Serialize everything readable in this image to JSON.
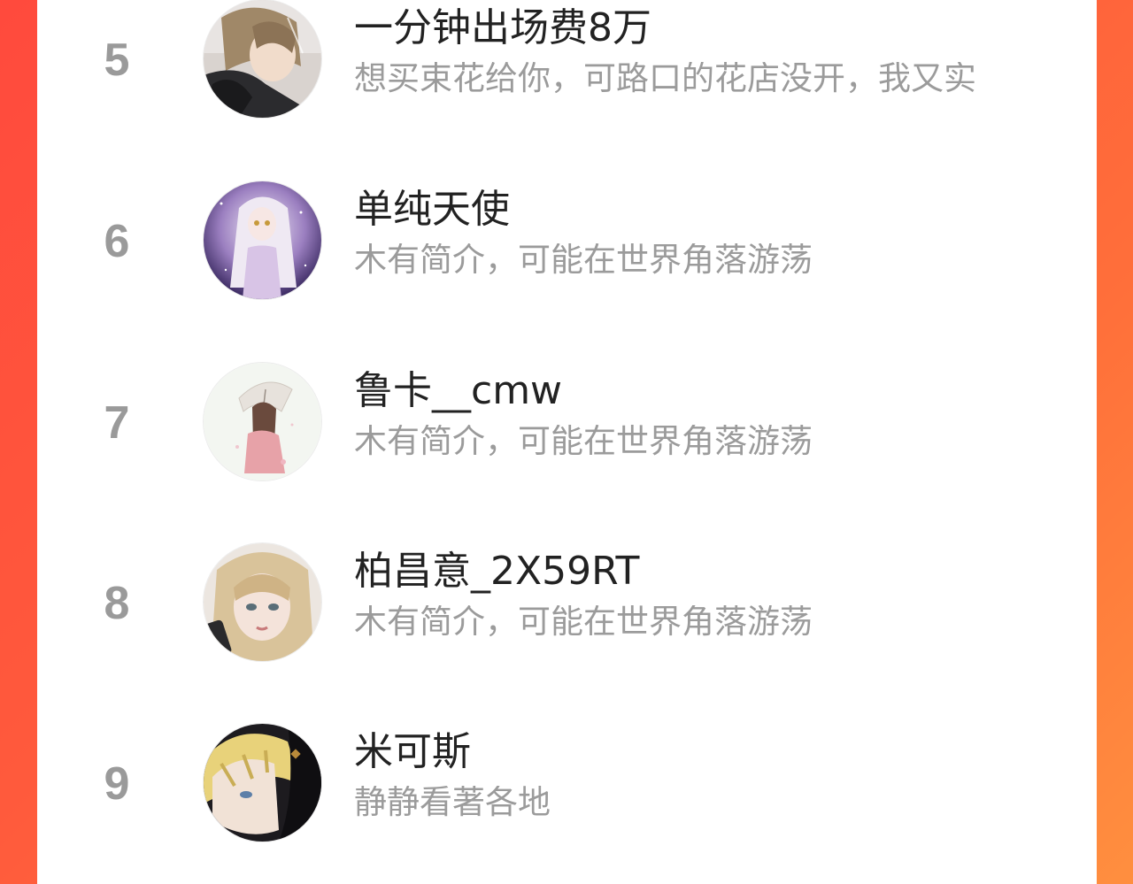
{
  "colors": {
    "background_start": "#ff4a3d",
    "background_end": "#ff8f3f",
    "panel": "#ffffff",
    "rank_text": "#9a9a9a",
    "name_text": "#222222",
    "desc_text": "#9b9b9b"
  },
  "ranking": {
    "items": [
      {
        "rank": "5",
        "name": "一分钟出场费8万",
        "desc": "想买束花给你，可路口的花店没开，我又实",
        "avatar": "avatar-anime-boy-dark-coat"
      },
      {
        "rank": "6",
        "name": "单纯天使",
        "desc": "木有简介，可能在世界角落游荡",
        "avatar": "avatar-anime-girl-purple"
      },
      {
        "rank": "7",
        "name": "鲁卡__cmw",
        "desc": "木有简介，可能在世界角落游荡",
        "avatar": "avatar-girl-umbrella"
      },
      {
        "rank": "8",
        "name": "柏昌意_2X59RT",
        "desc": "木有简介，可能在世界角落游荡",
        "avatar": "avatar-blonde-girl-phone"
      },
      {
        "rank": "9",
        "name": "米可斯",
        "desc": "静静看著各地",
        "avatar": "avatar-blonde-boy-dark"
      }
    ]
  }
}
